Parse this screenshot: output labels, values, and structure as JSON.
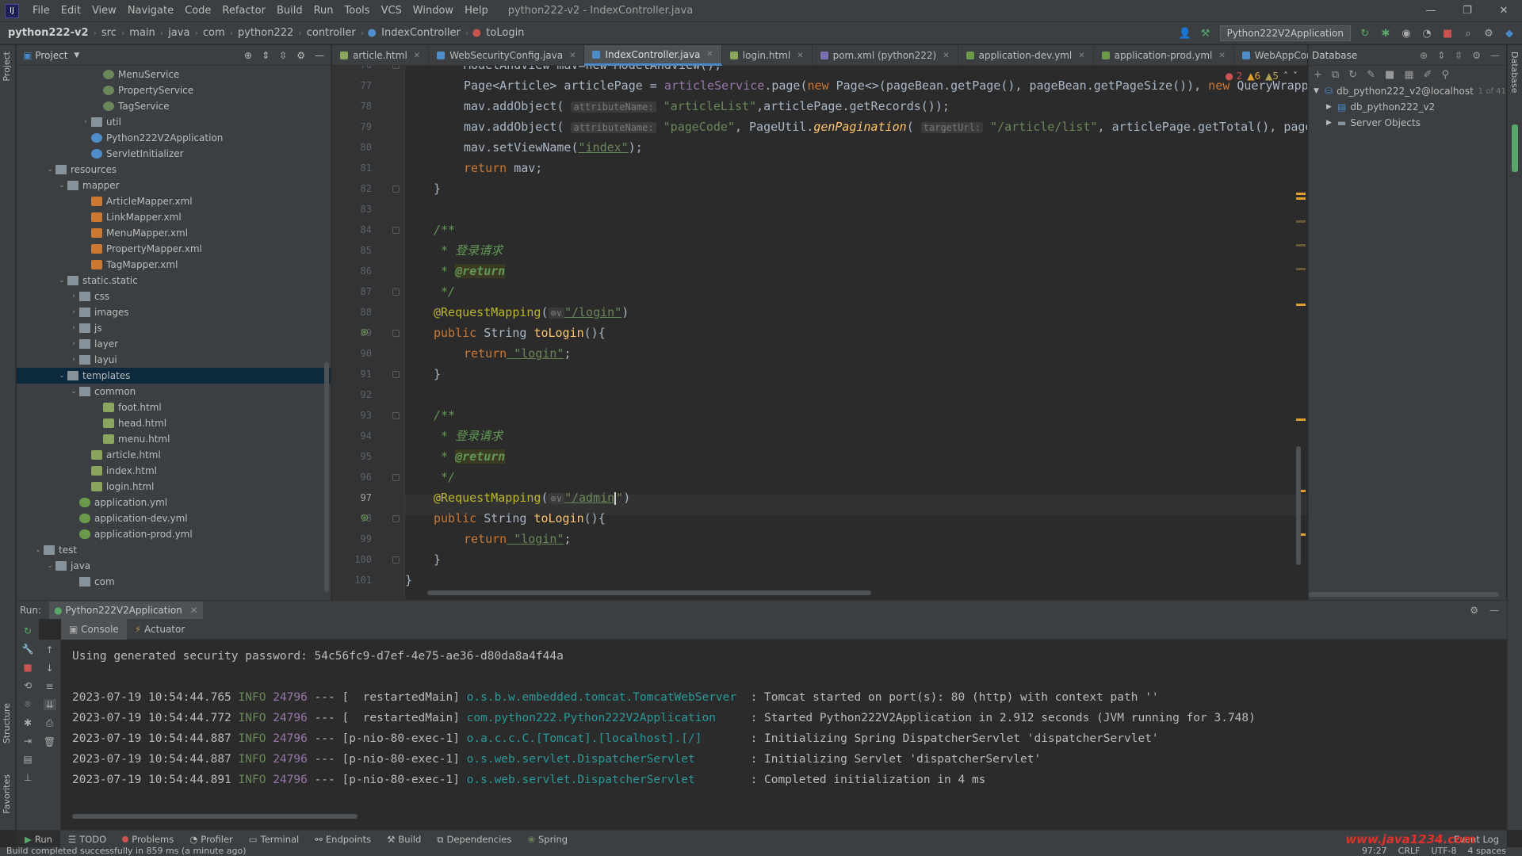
{
  "menubar": {
    "items": [
      "File",
      "Edit",
      "View",
      "Navigate",
      "Code",
      "Refactor",
      "Build",
      "Run",
      "Tools",
      "VCS",
      "Window",
      "Help"
    ],
    "window_title": "python222-v2 - IndexController.java"
  },
  "navbar": {
    "project": "python222-v2",
    "crumbs": [
      "src",
      "main",
      "java",
      "com",
      "python222",
      "controller",
      "IndexController",
      "toLogin"
    ],
    "run_config": "Python222V2Application"
  },
  "project_panel": {
    "title": "Project",
    "tree": [
      {
        "label": "MenuService",
        "depth": 7,
        "icon": "spring"
      },
      {
        "label": "PropertyService",
        "depth": 7,
        "icon": "spring"
      },
      {
        "label": "TagService",
        "depth": 7,
        "icon": "spring"
      },
      {
        "label": "util",
        "depth": 6,
        "icon": "folder",
        "arrow": "right"
      },
      {
        "label": "Python222V2Application",
        "depth": 6,
        "icon": "class"
      },
      {
        "label": "ServletInitializer",
        "depth": 6,
        "icon": "class"
      },
      {
        "label": "resources",
        "depth": 3,
        "icon": "folder",
        "arrow": "down"
      },
      {
        "label": "mapper",
        "depth": 4,
        "icon": "folder",
        "arrow": "down"
      },
      {
        "label": "ArticleMapper.xml",
        "depth": 6,
        "icon": "xml"
      },
      {
        "label": "LinkMapper.xml",
        "depth": 6,
        "icon": "xml"
      },
      {
        "label": "MenuMapper.xml",
        "depth": 6,
        "icon": "xml"
      },
      {
        "label": "PropertyMapper.xml",
        "depth": 6,
        "icon": "xml"
      },
      {
        "label": "TagMapper.xml",
        "depth": 6,
        "icon": "xml"
      },
      {
        "label": "static.static",
        "depth": 4,
        "icon": "folder",
        "arrow": "down"
      },
      {
        "label": "css",
        "depth": 5,
        "icon": "folder",
        "arrow": "right"
      },
      {
        "label": "images",
        "depth": 5,
        "icon": "folder",
        "arrow": "right"
      },
      {
        "label": "js",
        "depth": 5,
        "icon": "folder",
        "arrow": "right"
      },
      {
        "label": "layer",
        "depth": 5,
        "icon": "folder",
        "arrow": "right"
      },
      {
        "label": "layui",
        "depth": 5,
        "icon": "folder",
        "arrow": "right"
      },
      {
        "label": "templates",
        "depth": 4,
        "icon": "folder",
        "arrow": "down",
        "selected": true
      },
      {
        "label": "common",
        "depth": 5,
        "icon": "folder",
        "arrow": "down"
      },
      {
        "label": "foot.html",
        "depth": 7,
        "icon": "html"
      },
      {
        "label": "head.html",
        "depth": 7,
        "icon": "html"
      },
      {
        "label": "menu.html",
        "depth": 7,
        "icon": "html"
      },
      {
        "label": "article.html",
        "depth": 6,
        "icon": "html"
      },
      {
        "label": "index.html",
        "depth": 6,
        "icon": "html"
      },
      {
        "label": "login.html",
        "depth": 6,
        "icon": "html"
      },
      {
        "label": "application.yml",
        "depth": 5,
        "icon": "yml"
      },
      {
        "label": "application-dev.yml",
        "depth": 5,
        "icon": "yml"
      },
      {
        "label": "application-prod.yml",
        "depth": 5,
        "icon": "yml"
      },
      {
        "label": "test",
        "depth": 2,
        "icon": "folder",
        "arrow": "down"
      },
      {
        "label": "java",
        "depth": 3,
        "icon": "folder",
        "arrow": "down"
      },
      {
        "label": "com",
        "depth": 5,
        "icon": "folder"
      }
    ]
  },
  "tabs": [
    {
      "label": "article.html",
      "color": "#8aa65d",
      "active": false
    },
    {
      "label": "WebSecurityConfig.java",
      "color": "#4f8dc9",
      "active": false
    },
    {
      "label": "IndexController.java",
      "color": "#4f8dc9",
      "active": true
    },
    {
      "label": "login.html",
      "color": "#8aa65d",
      "active": false
    },
    {
      "label": "pom.xml (python222)",
      "color": "#7a6fb0",
      "active": false
    },
    {
      "label": "application-dev.yml",
      "color": "#6a9a4a",
      "active": false
    },
    {
      "label": "application-prod.yml",
      "color": "#6a9a4a",
      "active": false
    },
    {
      "label": "WebAppConfig",
      "color": "#4f8dc9",
      "active": false
    }
  ],
  "inspections": {
    "errors": "2",
    "warnings": "6",
    "weak": "5"
  },
  "editor": {
    "lines": [
      {
        "num": "76"
      },
      {
        "num": "77"
      },
      {
        "num": "78"
      },
      {
        "num": "79"
      },
      {
        "num": "80"
      },
      {
        "num": "81"
      },
      {
        "num": "82"
      },
      {
        "num": "83"
      },
      {
        "num": "84"
      },
      {
        "num": "85"
      },
      {
        "num": "86"
      },
      {
        "num": "87"
      },
      {
        "num": "88"
      },
      {
        "num": "89"
      },
      {
        "num": "90"
      },
      {
        "num": "91"
      },
      {
        "num": "92"
      },
      {
        "num": "93"
      },
      {
        "num": "94"
      },
      {
        "num": "95"
      },
      {
        "num": "96"
      },
      {
        "num": "97"
      },
      {
        "num": "98"
      },
      {
        "num": "99"
      },
      {
        "num": "100"
      },
      {
        "num": "101"
      }
    ],
    "current_line": "97",
    "code": {
      "l76": "ModelAndView mav=new ModelAndView();",
      "l77_a": "Page<Article> articlePage = ",
      "l77_b": "articleService",
      "l77_c": ".page(",
      "l77_d": "new",
      "l77_e": " Page<>(pageBean.getPage(), pageBean.getPageSize()), ",
      "l77_f": "new",
      "l77_g": " QueryWrapp",
      "l78_a": "mav.addObject( ",
      "l78_hint": "attributeName:",
      "l78_str": " \"articleList\"",
      "l78_b": ",articlePage.getRecords());",
      "l79_a": "mav.addObject( ",
      "l79_hint": "attributeName:",
      "l79_str": " \"pageCode\"",
      "l79_b": ", PageUtil.",
      "l79_fn": "genPagination",
      "l79_c": "( ",
      "l79_hint2": "targetUrl:",
      "l79_str2": " \"/article/list\"",
      "l79_d": ", articlePage.getTotal(), pageBea",
      "l80_a": "mav.setViewName(",
      "l80_str": "\"index\"",
      "l80_b": ");",
      "l81_kw": "return",
      "l81_b": " mav;",
      "l82": "}",
      "l84": "/**",
      "l85": " * 登录请求",
      "l86_a": " * ",
      "l86_tag": "@return",
      "l87": " */",
      "l88_ann": "@RequestMapping",
      "l88_a": "(",
      "l88_globe": "⊕∨",
      "l88_str": "\"/login\"",
      "l88_b": ")",
      "l89_kw": "public",
      "l89_a": " String ",
      "l89_fn": "toLogin",
      "l89_b": "(){",
      "l90_kw": "return",
      "l90_str": " \"login\"",
      "l90_b": ";",
      "l91": "}",
      "l93": "/**",
      "l94": " * 登录请求",
      "l95_a": " * ",
      "l95_tag": "@return",
      "l96": " */",
      "l97_ann": "@RequestMapping",
      "l97_a": "(",
      "l97_globe": "⊕∨",
      "l97_str": "\"/admin",
      "l97_str_end": "\"",
      "l97_b": ")",
      "l98_kw": "public",
      "l98_a": " String ",
      "l98_fn": "toLogin",
      "l98_b": "(){",
      "l99_kw": "return",
      "l99_str": " \"login\"",
      "l99_b": ";",
      "l100": "}",
      "l101": "}"
    }
  },
  "database_panel": {
    "title": "Database",
    "items": [
      {
        "label": "db_python222_v2@localhost",
        "suffix": "1 of 41"
      },
      {
        "label": "db_python222_v2"
      },
      {
        "label": "Server Objects"
      }
    ]
  },
  "run_panel": {
    "label": "Run:",
    "config": "Python222V2Application",
    "subtabs": [
      "Console",
      "Actuator"
    ],
    "password_line": "Using generated security password: 54c56fc9-d7ef-4e75-ae36-d80da8a4f44a",
    "logs": [
      {
        "ts": "2023-07-19 10:54:44.765",
        "level": "INFO",
        "pid": "24796",
        "sep": "---",
        "thread": "[  restartedMain]",
        "logger": "o.s.b.w.embedded.tomcat.TomcatWebServer ",
        "msg": ": Tomcat started on port(s): 80 (http) with context path ''"
      },
      {
        "ts": "2023-07-19 10:54:44.772",
        "level": "INFO",
        "pid": "24796",
        "sep": "---",
        "thread": "[  restartedMain]",
        "logger": "com.python222.Python222V2Application    ",
        "msg": ": Started Python222V2Application in 2.912 seconds (JVM running for 3.748)"
      },
      {
        "ts": "2023-07-19 10:54:44.887",
        "level": "INFO",
        "pid": "24796",
        "sep": "---",
        "thread": "[p-nio-80-exec-1]",
        "logger": "o.a.c.c.C.[Tomcat].[localhost].[/]      ",
        "msg": ": Initializing Spring DispatcherServlet 'dispatcherServlet'"
      },
      {
        "ts": "2023-07-19 10:54:44.887",
        "level": "INFO",
        "pid": "24796",
        "sep": "---",
        "thread": "[p-nio-80-exec-1]",
        "logger": "o.s.web.servlet.DispatcherServlet       ",
        "msg": ": Initializing Servlet 'dispatcherServlet'"
      },
      {
        "ts": "2023-07-19 10:54:44.891",
        "level": "INFO",
        "pid": "24796",
        "sep": "---",
        "thread": "[p-nio-80-exec-1]",
        "logger": "o.s.web.servlet.DispatcherServlet       ",
        "msg": ": Completed initialization in 4 ms"
      }
    ]
  },
  "tool_tabs": [
    "Run",
    "TODO",
    "Problems",
    "Profiler",
    "Terminal",
    "Endpoints",
    "Build",
    "Dependencies",
    "Spring"
  ],
  "watermark": "www.java1234.com",
  "event_log": "Event Log",
  "statusbar": {
    "message": "Build completed successfully in 859 ms (a minute ago)",
    "position": "97:27",
    "line_sep": "CRLF",
    "encoding": "UTF-8",
    "indent": "4 spaces"
  },
  "side_labels": {
    "project": "Project",
    "structure": "Structure",
    "favorites": "Favorites",
    "database": "Database"
  },
  "colors": {
    "accent": "#4a88c7",
    "keyword": "#cc7832",
    "string": "#6a8759",
    "annotation": "#bbb529",
    "error": "#e0302a"
  }
}
